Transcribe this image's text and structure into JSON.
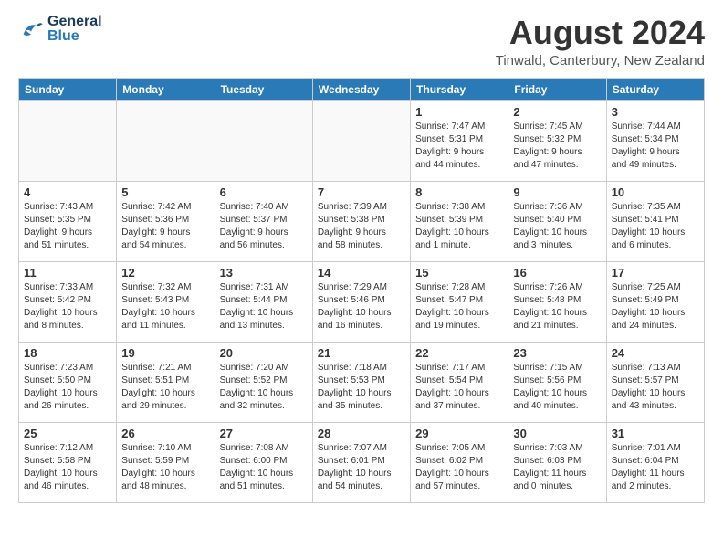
{
  "header": {
    "logo_general": "General",
    "logo_blue": "Blue",
    "month_year": "August 2024",
    "location": "Tinwald, Canterbury, New Zealand"
  },
  "days_of_week": [
    "Sunday",
    "Monday",
    "Tuesday",
    "Wednesday",
    "Thursday",
    "Friday",
    "Saturday"
  ],
  "weeks": [
    [
      {
        "day": "",
        "info": ""
      },
      {
        "day": "",
        "info": ""
      },
      {
        "day": "",
        "info": ""
      },
      {
        "day": "",
        "info": ""
      },
      {
        "day": "1",
        "info": "Sunrise: 7:47 AM\nSunset: 5:31 PM\nDaylight: 9 hours\nand 44 minutes."
      },
      {
        "day": "2",
        "info": "Sunrise: 7:45 AM\nSunset: 5:32 PM\nDaylight: 9 hours\nand 47 minutes."
      },
      {
        "day": "3",
        "info": "Sunrise: 7:44 AM\nSunset: 5:34 PM\nDaylight: 9 hours\nand 49 minutes."
      }
    ],
    [
      {
        "day": "4",
        "info": "Sunrise: 7:43 AM\nSunset: 5:35 PM\nDaylight: 9 hours\nand 51 minutes."
      },
      {
        "day": "5",
        "info": "Sunrise: 7:42 AM\nSunset: 5:36 PM\nDaylight: 9 hours\nand 54 minutes."
      },
      {
        "day": "6",
        "info": "Sunrise: 7:40 AM\nSunset: 5:37 PM\nDaylight: 9 hours\nand 56 minutes."
      },
      {
        "day": "7",
        "info": "Sunrise: 7:39 AM\nSunset: 5:38 PM\nDaylight: 9 hours\nand 58 minutes."
      },
      {
        "day": "8",
        "info": "Sunrise: 7:38 AM\nSunset: 5:39 PM\nDaylight: 10 hours\nand 1 minute."
      },
      {
        "day": "9",
        "info": "Sunrise: 7:36 AM\nSunset: 5:40 PM\nDaylight: 10 hours\nand 3 minutes."
      },
      {
        "day": "10",
        "info": "Sunrise: 7:35 AM\nSunset: 5:41 PM\nDaylight: 10 hours\nand 6 minutes."
      }
    ],
    [
      {
        "day": "11",
        "info": "Sunrise: 7:33 AM\nSunset: 5:42 PM\nDaylight: 10 hours\nand 8 minutes."
      },
      {
        "day": "12",
        "info": "Sunrise: 7:32 AM\nSunset: 5:43 PM\nDaylight: 10 hours\nand 11 minutes."
      },
      {
        "day": "13",
        "info": "Sunrise: 7:31 AM\nSunset: 5:44 PM\nDaylight: 10 hours\nand 13 minutes."
      },
      {
        "day": "14",
        "info": "Sunrise: 7:29 AM\nSunset: 5:46 PM\nDaylight: 10 hours\nand 16 minutes."
      },
      {
        "day": "15",
        "info": "Sunrise: 7:28 AM\nSunset: 5:47 PM\nDaylight: 10 hours\nand 19 minutes."
      },
      {
        "day": "16",
        "info": "Sunrise: 7:26 AM\nSunset: 5:48 PM\nDaylight: 10 hours\nand 21 minutes."
      },
      {
        "day": "17",
        "info": "Sunrise: 7:25 AM\nSunset: 5:49 PM\nDaylight: 10 hours\nand 24 minutes."
      }
    ],
    [
      {
        "day": "18",
        "info": "Sunrise: 7:23 AM\nSunset: 5:50 PM\nDaylight: 10 hours\nand 26 minutes."
      },
      {
        "day": "19",
        "info": "Sunrise: 7:21 AM\nSunset: 5:51 PM\nDaylight: 10 hours\nand 29 minutes."
      },
      {
        "day": "20",
        "info": "Sunrise: 7:20 AM\nSunset: 5:52 PM\nDaylight: 10 hours\nand 32 minutes."
      },
      {
        "day": "21",
        "info": "Sunrise: 7:18 AM\nSunset: 5:53 PM\nDaylight: 10 hours\nand 35 minutes."
      },
      {
        "day": "22",
        "info": "Sunrise: 7:17 AM\nSunset: 5:54 PM\nDaylight: 10 hours\nand 37 minutes."
      },
      {
        "day": "23",
        "info": "Sunrise: 7:15 AM\nSunset: 5:56 PM\nDaylight: 10 hours\nand 40 minutes."
      },
      {
        "day": "24",
        "info": "Sunrise: 7:13 AM\nSunset: 5:57 PM\nDaylight: 10 hours\nand 43 minutes."
      }
    ],
    [
      {
        "day": "25",
        "info": "Sunrise: 7:12 AM\nSunset: 5:58 PM\nDaylight: 10 hours\nand 46 minutes."
      },
      {
        "day": "26",
        "info": "Sunrise: 7:10 AM\nSunset: 5:59 PM\nDaylight: 10 hours\nand 48 minutes."
      },
      {
        "day": "27",
        "info": "Sunrise: 7:08 AM\nSunset: 6:00 PM\nDaylight: 10 hours\nand 51 minutes."
      },
      {
        "day": "28",
        "info": "Sunrise: 7:07 AM\nSunset: 6:01 PM\nDaylight: 10 hours\nand 54 minutes."
      },
      {
        "day": "29",
        "info": "Sunrise: 7:05 AM\nSunset: 6:02 PM\nDaylight: 10 hours\nand 57 minutes."
      },
      {
        "day": "30",
        "info": "Sunrise: 7:03 AM\nSunset: 6:03 PM\nDaylight: 11 hours\nand 0 minutes."
      },
      {
        "day": "31",
        "info": "Sunrise: 7:01 AM\nSunset: 6:04 PM\nDaylight: 11 hours\nand 2 minutes."
      }
    ]
  ]
}
